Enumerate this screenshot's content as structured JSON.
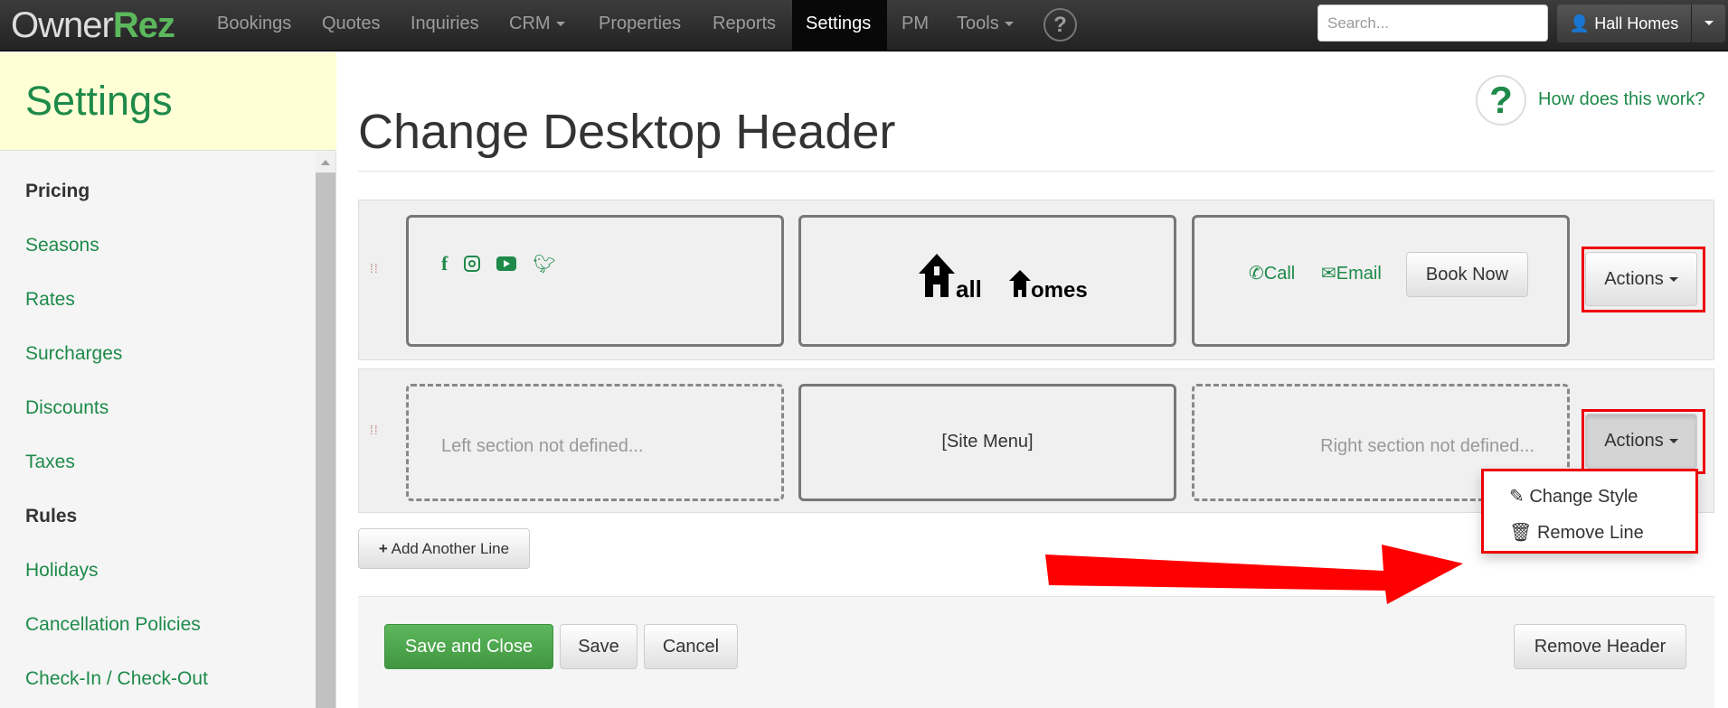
{
  "nav": {
    "logo_owner": "Owner",
    "logo_rez": "Rez",
    "items": [
      "Bookings",
      "Quotes",
      "Inquiries",
      "CRM",
      "Properties",
      "Reports",
      "Settings",
      "PM",
      "Tools"
    ],
    "help": "?",
    "search_placeholder": "Search...",
    "user": "Hall Homes"
  },
  "sidebar": {
    "title": "Settings",
    "items": [
      {
        "label": "Pricing",
        "heading": true
      },
      {
        "label": "Seasons"
      },
      {
        "label": "Rates"
      },
      {
        "label": "Surcharges"
      },
      {
        "label": "Discounts"
      },
      {
        "label": "Taxes"
      },
      {
        "label": "Rules",
        "heading": true
      },
      {
        "label": "Holidays"
      },
      {
        "label": "Cancellation Policies"
      },
      {
        "label": "Check-In / Check-Out"
      }
    ]
  },
  "page": {
    "title": "Change Desktop Header",
    "help_icon": "?",
    "help_link": "How does this work?"
  },
  "line1": {
    "social_icons": [
      "facebook-icon",
      "instagram-icon",
      "youtube-icon",
      "twitter-icon"
    ],
    "logo_text": "Hall Homes",
    "call": "Call",
    "email": "Email",
    "book_now": "Book Now",
    "actions": "Actions"
  },
  "line2": {
    "left": "Left section not defined...",
    "center": "[Site Menu]",
    "right": "Right section not defined...",
    "actions": "Actions"
  },
  "dropdown": {
    "items": [
      "Change Style",
      "Remove Line"
    ]
  },
  "add_line": "Add Another Line",
  "footer": {
    "save_close": "Save and Close",
    "save": "Save",
    "cancel": "Cancel",
    "remove_header": "Remove Header"
  },
  "colors": {
    "brand_green": "#1e8a4a",
    "highlight": "#ee0000"
  }
}
